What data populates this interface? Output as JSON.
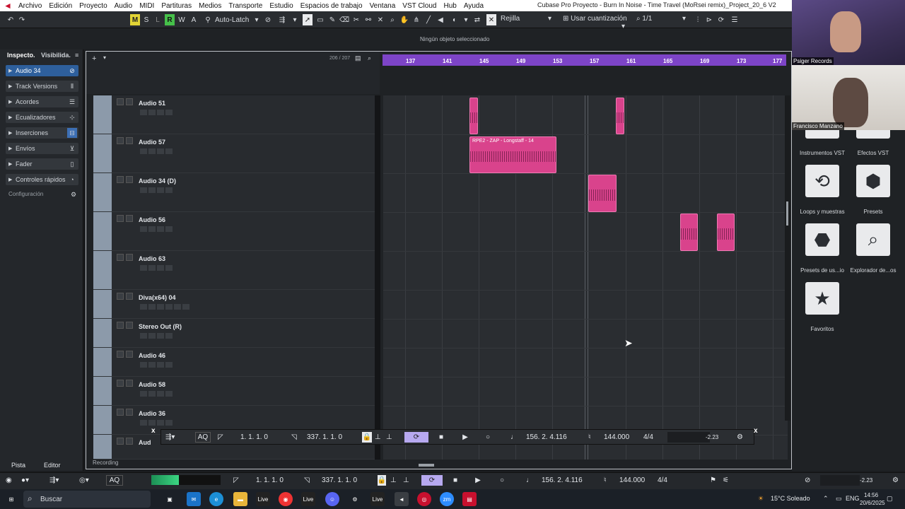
{
  "menu": {
    "items": [
      "Archivo",
      "Edición",
      "Proyecto",
      "Audio",
      "MIDI",
      "Partituras",
      "Medios",
      "Transporte",
      "Estudio",
      "Espacios de trabajo",
      "Ventana",
      "VST Cloud",
      "Hub",
      "Ayuda"
    ],
    "window_title": "Cubase Pro Proyecto - Burn In Noise - Time Travel (MoRsei remix)_Project_20_6 V2"
  },
  "toolbar": {
    "m": "M",
    "s": "S",
    "l": "L",
    "r": "R",
    "w": "W",
    "a": "A",
    "automation_mode": "Auto-Latch",
    "snap": "Rejilla",
    "quantize": "Usar cuantización",
    "zoom": "1/1"
  },
  "infoline": {
    "status": "Ningún objeto seleccionado"
  },
  "inspector": {
    "tab_inspector": "Inspecto.",
    "tab_visibility": "Visibilida.",
    "rows": [
      "Audio 34",
      "Track Versions",
      "Acordes",
      "Ecualizadores",
      "Inserciones",
      "Envíos",
      "Fader",
      "Controles rápidos"
    ],
    "config": "Configuración",
    "bottom_tab_track": "Pista",
    "bottom_tab_editor": "Editor"
  },
  "project": {
    "track_counter": "206 / 207",
    "ruler": [
      "137",
      "141",
      "145",
      "149",
      "153",
      "157",
      "161",
      "165",
      "169",
      "173",
      "177"
    ],
    "tracks": [
      {
        "name": "Audio 51"
      },
      {
        "name": "Audio 57"
      },
      {
        "name": "Audio 34 (D)"
      },
      {
        "name": "Audio 56"
      },
      {
        "name": "Audio 63"
      },
      {
        "name": "Diva(x64) 04"
      },
      {
        "name": "Stereo Out (R)"
      },
      {
        "name": "Audio 46"
      },
      {
        "name": "Audio 58"
      },
      {
        "name": "Audio 36"
      },
      {
        "name": "Aud"
      }
    ],
    "clip_name": "RPE2 - ZAP - Longstaff - 14",
    "recording_label": "Recording"
  },
  "transport": {
    "aq": "AQ",
    "left_locator": "1. 1. 1. 0",
    "right_locator": "337. 1. 1. 0",
    "position": "156. 2. 4.116",
    "tempo": "144.000",
    "signature": "4/4",
    "level": "-2.23",
    "close": "x"
  },
  "rightpanel": {
    "cam1_name": "Psiger Records",
    "cam2_name": "Francisco Manzano",
    "items": [
      "Instrumentos VST",
      "Efectos VST",
      "Loops y muestras",
      "Presets",
      "Presets de us...io",
      "Explorador de...os",
      "Favoritos"
    ]
  },
  "taskbar": {
    "search": "Buscar",
    "live1": "Live",
    "live2": "Live",
    "live3": "Live",
    "zm": "zm",
    "weather": "15°C  Soleado",
    "lang": "ENG",
    "time": "14:56",
    "date": "20/6/2025"
  },
  "colors": {
    "accent_purple": "#7d44c7",
    "clip_pink": "#d9438c",
    "track_color": "#8c9aaa"
  }
}
